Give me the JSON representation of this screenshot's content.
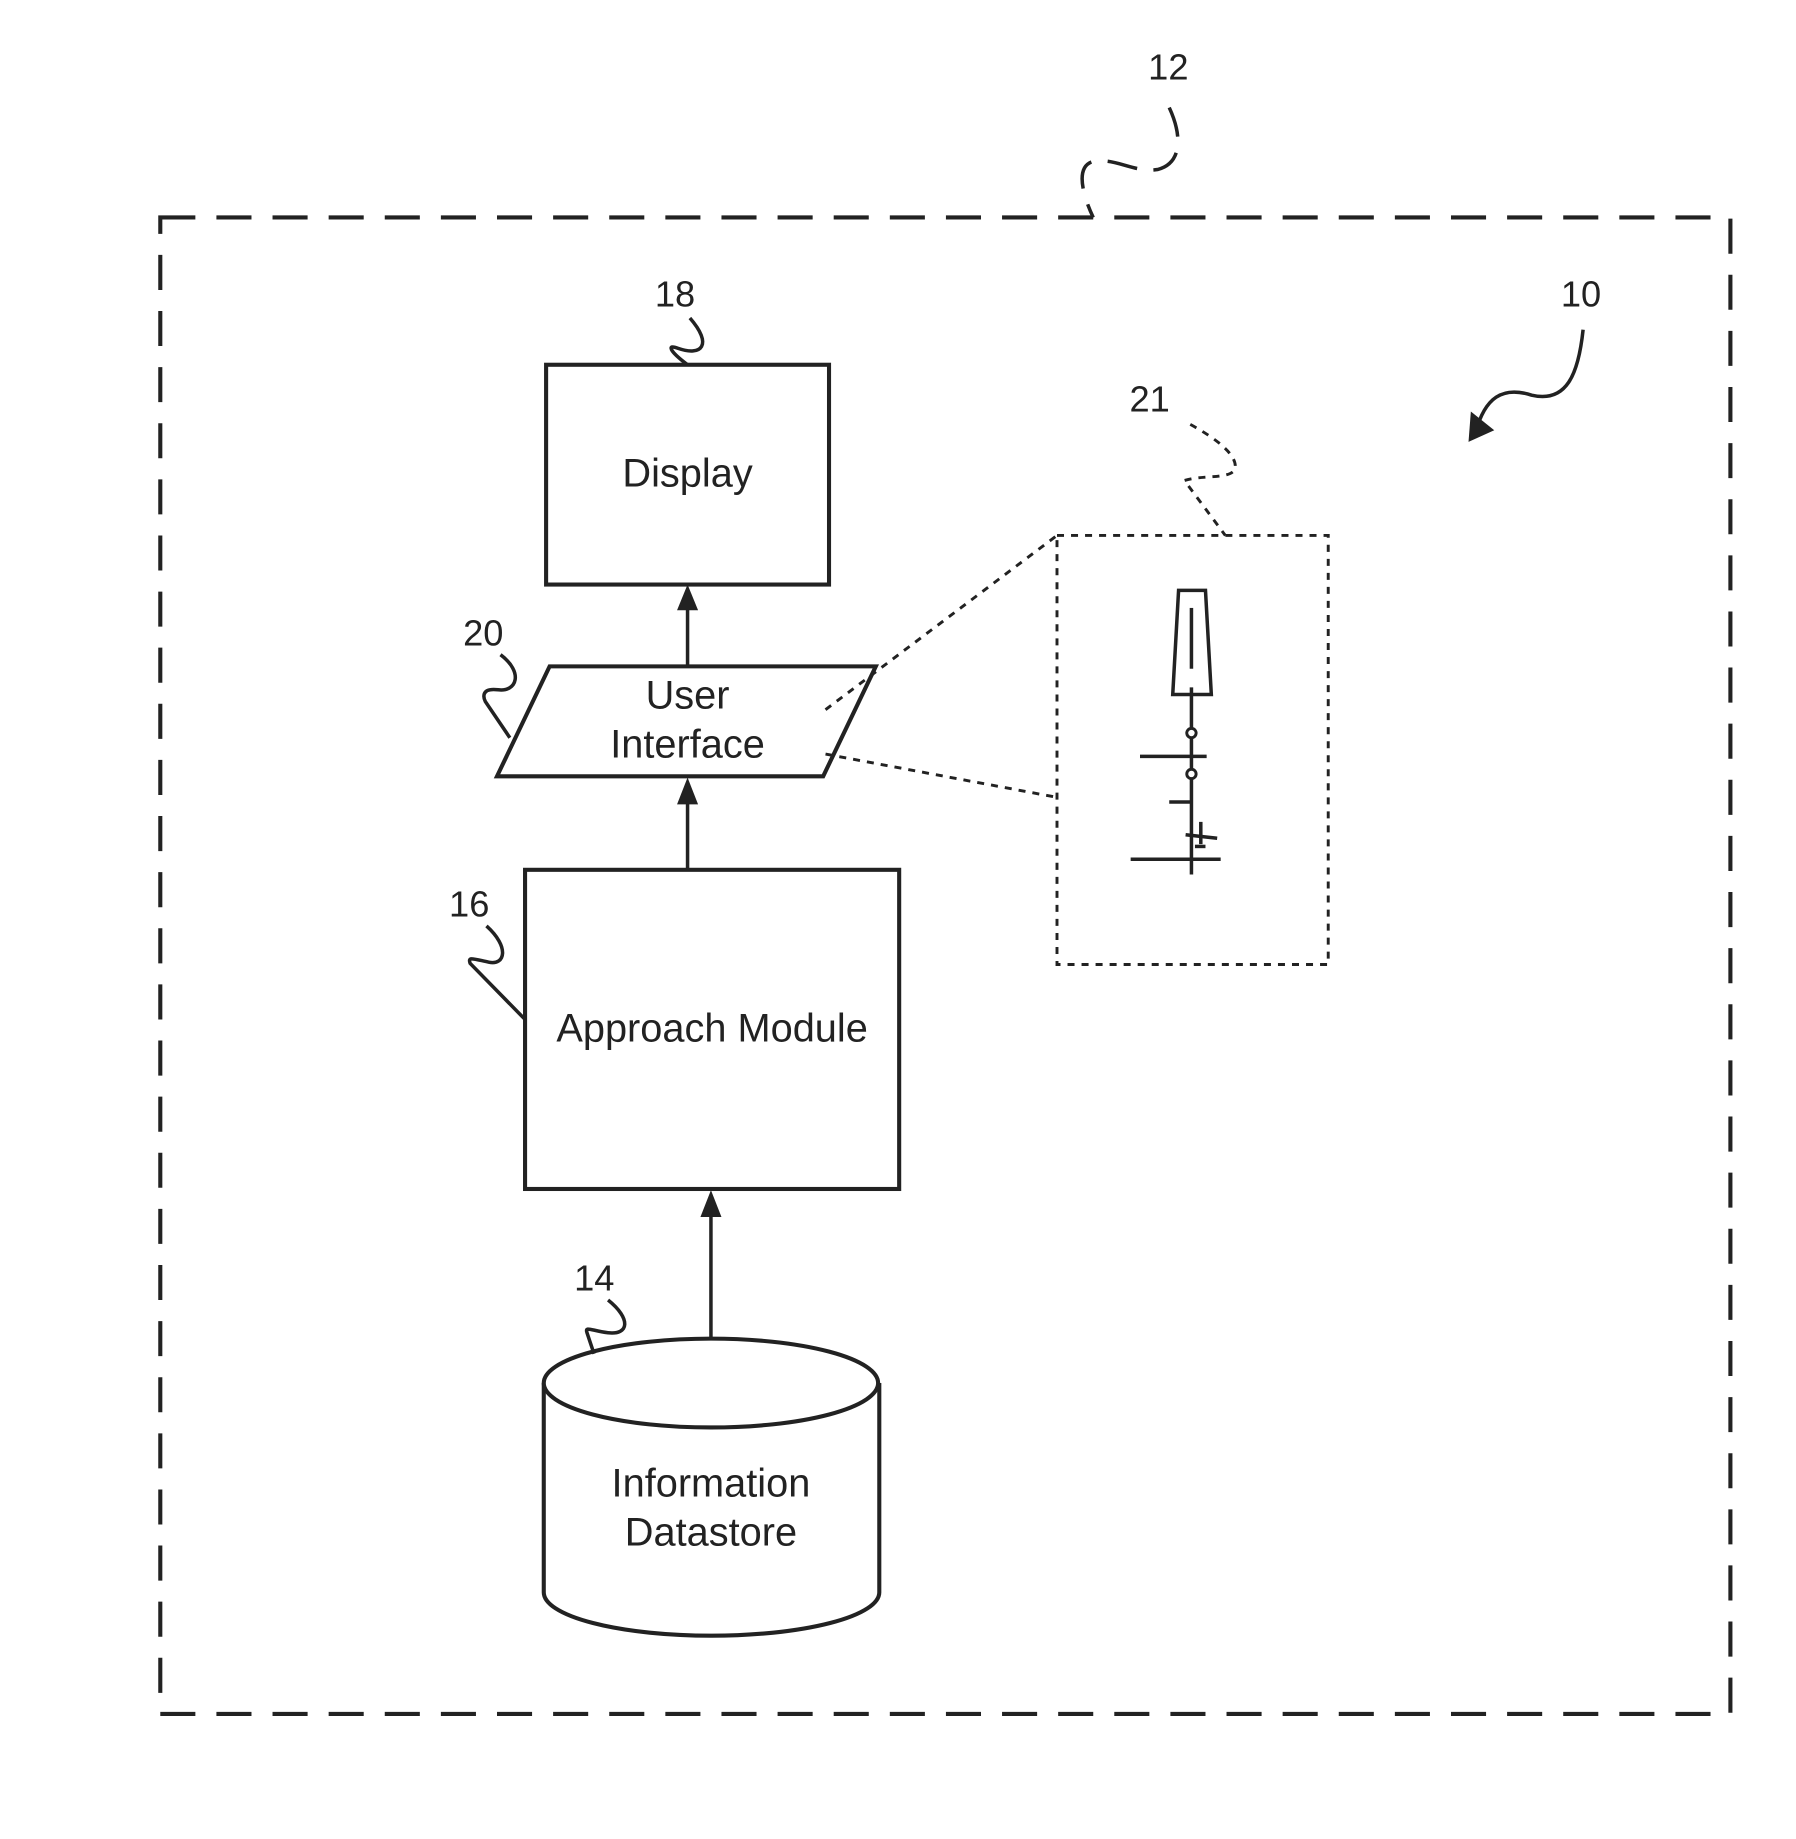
{
  "diagram": {
    "system_ref": "12",
    "subsystem_ref": "10",
    "blocks": {
      "display": {
        "ref": "18",
        "label": "Display"
      },
      "user_interface": {
        "ref": "20",
        "label_line1": "User",
        "label_line2": "Interface"
      },
      "approach_module": {
        "ref": "16",
        "label": "Approach Module"
      },
      "datastore": {
        "ref": "14",
        "label_line1": "Information",
        "label_line2": "Datastore"
      }
    },
    "callout": {
      "ref": "21",
      "content": "approach display detail: runway symbol, approach path with waypoints and aircraft symbol"
    },
    "connections": [
      {
        "from": "datastore",
        "to": "approach_module"
      },
      {
        "from": "approach_module",
        "to": "user_interface"
      },
      {
        "from": "user_interface",
        "to": "display"
      }
    ]
  }
}
